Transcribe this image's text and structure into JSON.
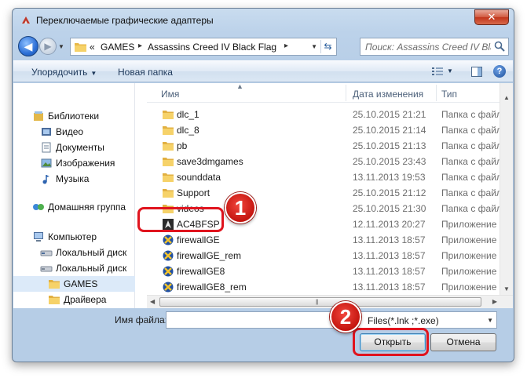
{
  "window": {
    "title": "Переключаемые графические адаптеры",
    "close_label": "✕"
  },
  "address": {
    "prefix": "«",
    "crumbs": [
      "GAMES",
      "Assassins Creed IV Black Flag"
    ],
    "separator": "▸"
  },
  "search": {
    "placeholder": "Поиск: Assassins Creed IV Bla..."
  },
  "toolbar": {
    "organize_label": "Упорядочить",
    "new_folder_label": "Новая папка",
    "help_label": "?"
  },
  "sidebar": {
    "items": [
      {
        "label": "Библиотеки",
        "icon": "libraries-icon"
      },
      {
        "label": "Видео",
        "icon": "video-icon"
      },
      {
        "label": "Документы",
        "icon": "documents-icon"
      },
      {
        "label": "Изображения",
        "icon": "pictures-icon"
      },
      {
        "label": "Музыка",
        "icon": "music-icon"
      },
      {
        "label": "Домашняя группа",
        "icon": "homegroup-icon"
      },
      {
        "label": "Компьютер",
        "icon": "computer-icon"
      },
      {
        "label": "Локальный диск",
        "icon": "disk-icon"
      },
      {
        "label": "Локальный диск",
        "icon": "disk-icon"
      },
      {
        "label": "GAMES",
        "icon": "folder-icon"
      },
      {
        "label": "Драйвера",
        "icon": "folder-icon"
      }
    ]
  },
  "columns": {
    "name": "Имя",
    "date": "Дата изменения",
    "type": "Тип"
  },
  "files": [
    {
      "name": "dlc_1",
      "date": "25.10.2015 21:21",
      "type": "Папка с файлами",
      "kind": "folder"
    },
    {
      "name": "dlc_8",
      "date": "25.10.2015 21:14",
      "type": "Папка с файлами",
      "kind": "folder"
    },
    {
      "name": "pb",
      "date": "25.10.2015 21:13",
      "type": "Папка с файлами",
      "kind": "folder"
    },
    {
      "name": "save3dmgames",
      "date": "25.10.2015 23:43",
      "type": "Папка с файлами",
      "kind": "folder"
    },
    {
      "name": "sounddata",
      "date": "13.11.2013 19:53",
      "type": "Папка с файлами",
      "kind": "folder"
    },
    {
      "name": "Support",
      "date": "25.10.2015 21:12",
      "type": "Папка с файлами",
      "kind": "folder"
    },
    {
      "name": "videos",
      "date": "25.10.2015 21:30",
      "type": "Папка с файлами",
      "kind": "folder"
    },
    {
      "name": "AC4BFSP",
      "date": "12.11.2013 20:27",
      "type": "Приложение",
      "kind": "app"
    },
    {
      "name": "firewallGE",
      "date": "13.11.2013 18:57",
      "type": "Приложение",
      "kind": "firewall"
    },
    {
      "name": "firewallGE_rem",
      "date": "13.11.2013 18:57",
      "type": "Приложение",
      "kind": "firewall"
    },
    {
      "name": "firewallGE8",
      "date": "13.11.2013 18:57",
      "type": "Приложение",
      "kind": "firewall"
    },
    {
      "name": "firewallGE8_rem",
      "date": "13.11.2013 18:57",
      "type": "Приложение",
      "kind": "firewall"
    }
  ],
  "bottom": {
    "filename_label": "Имя файла:",
    "filename_value": "",
    "filter_value": "Files(*.lnk ;*.exe)",
    "open_label": "Открыть",
    "cancel_label": "Отмена"
  },
  "annotations": {
    "badge_1": "1",
    "badge_2": "2",
    "highlight_color": "#e0141e"
  }
}
